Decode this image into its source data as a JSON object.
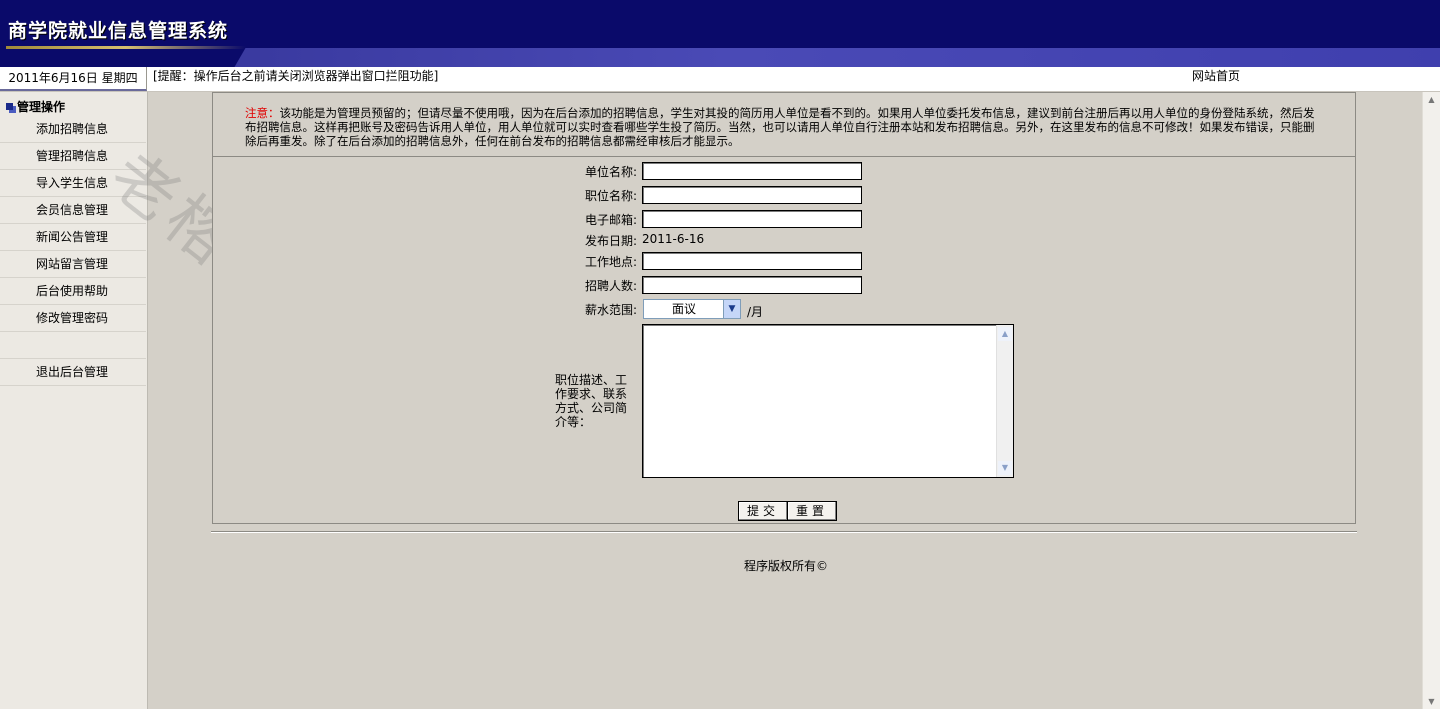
{
  "header": {
    "title": "商学院就业信息管理系统"
  },
  "infobar": {
    "date": "2011年6月16日  星期四",
    "notice": "[提醒：操作后台之前请关闭浏览器弹出窗口拦阻功能]",
    "home_link": "网站首页"
  },
  "sidebar": {
    "section_title": "管理操作",
    "items": [
      {
        "label": "添加招聘信息"
      },
      {
        "label": "管理招聘信息"
      },
      {
        "label": "导入学生信息"
      },
      {
        "label": "会员信息管理"
      },
      {
        "label": "新闻公告管理"
      },
      {
        "label": "网站留言管理"
      },
      {
        "label": "后台使用帮助"
      },
      {
        "label": "修改管理密码"
      }
    ],
    "logout": "退出后台管理"
  },
  "watermark": "老榕树网络",
  "note": {
    "label": "注意：",
    "text": "该功能是为管理员预留的；但请尽量不使用哦，因为在后台添加的招聘信息，学生对其投的简历用人单位是看不到的。如果用人单位委托发布信息，建议到前台注册后再以用人单位的身份登陆系统，然后发布招聘信息。这样再把账号及密码告诉用人单位，用人单位就可以实时查看哪些学生投了简历。当然，也可以请用人单位自行注册本站和发布招聘信息。另外，在这里发布的信息不可修改！如果发布错误，只能删除后再重发。除了在后台添加的招聘信息外，任何在前台发布的招聘信息都需经审核后才能显示。"
  },
  "form": {
    "company_label": "单位名称:",
    "company_value": "",
    "position_label": "职位名称:",
    "position_value": "",
    "email_label": "电子邮箱:",
    "email_value": "",
    "date_label": "发布日期:",
    "date_value": "2011-6-16",
    "location_label": "工作地点:",
    "location_value": "",
    "count_label": "招聘人数:",
    "count_value": "",
    "salary_label": "薪水范围:",
    "salary_value": "面议",
    "salary_unit": "/月",
    "desc_label": "职位描述、工作要求、联系方式、公司简介等：",
    "submit": "提交",
    "reset": "重置"
  },
  "footer": {
    "copyright": "程序版权所有©"
  }
}
